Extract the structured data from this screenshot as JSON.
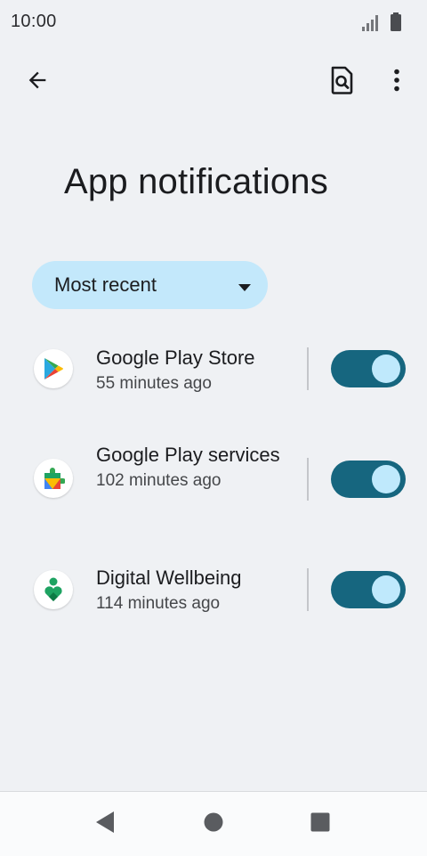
{
  "status_bar": {
    "time": "10:00",
    "icons": [
      "signal-icon",
      "battery-icon"
    ]
  },
  "top_bar": {
    "icons": [
      "back-arrow-icon",
      "search-settings-icon",
      "more-vert-icon"
    ]
  },
  "page": {
    "title": "App notifications"
  },
  "sort": {
    "label": "Most recent",
    "icon": "caret-down-icon"
  },
  "apps": [
    {
      "name": "Google Play Store",
      "time": "55 minutes ago",
      "icon": "google-play-store-icon",
      "enabled": true
    },
    {
      "name": "Google Play services",
      "time": "102 minutes ago",
      "icon": "google-play-services-icon",
      "enabled": true
    },
    {
      "name": "Digital Wellbeing",
      "time": "114 minutes ago",
      "icon": "digital-wellbeing-icon",
      "enabled": true
    }
  ],
  "colors": {
    "background": "#eff1f4",
    "chip": "#c3e8fb",
    "toggle_track": "#16667f",
    "toggle_thumb": "#bfe9fc"
  },
  "nav_bar": {
    "icons": [
      "nav-back-icon",
      "nav-home-icon",
      "nav-recents-icon"
    ]
  }
}
